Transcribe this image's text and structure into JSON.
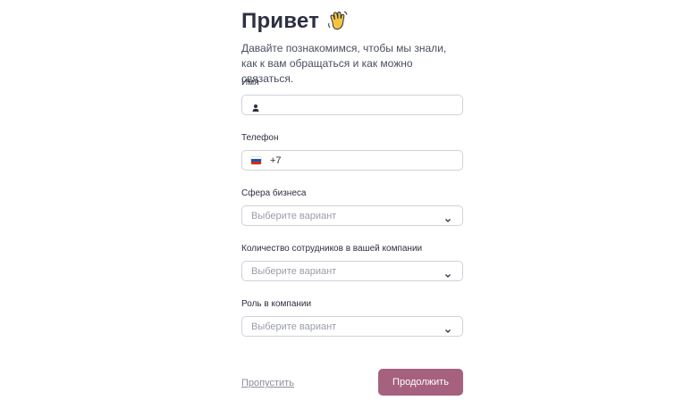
{
  "header": {
    "title": "Привет",
    "subtitle": "Давайте познакомимся, чтобы мы знали, как к вам обращаться и как можно связаться."
  },
  "fields": {
    "name": {
      "label": "Имя",
      "value": "",
      "icon": "user-icon"
    },
    "phone": {
      "label": "Телефон",
      "value": "+7",
      "flag": "russia-flag-icon"
    },
    "business": {
      "label": "Сфера бизнеса",
      "placeholder": "Выберите вариант"
    },
    "employees": {
      "label": "Количество сотрудников в вашей компании",
      "placeholder": "Выберите вариант"
    },
    "role": {
      "label": "Роль в компании",
      "placeholder": "Выберите вариант"
    }
  },
  "actions": {
    "skip_label": "Пропустить",
    "continue_label": "Продолжить"
  },
  "colors": {
    "primary_button": "#a6617f",
    "border": "#cfd2d8",
    "placeholder": "#9a9ea8"
  }
}
